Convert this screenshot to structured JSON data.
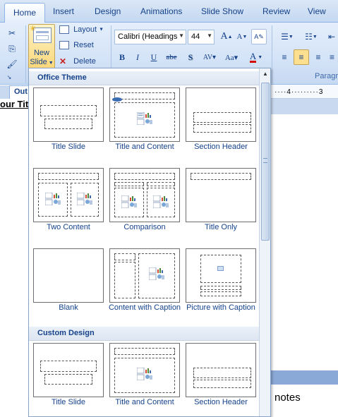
{
  "tabs": [
    {
      "label": "Home",
      "active": true
    },
    {
      "label": "Insert",
      "active": false
    },
    {
      "label": "Design",
      "active": false
    },
    {
      "label": "Animations",
      "active": false
    },
    {
      "label": "Slide Show",
      "active": false
    },
    {
      "label": "Review",
      "active": false
    },
    {
      "label": "View",
      "active": false
    }
  ],
  "ribbon": {
    "new_slide_label_1": "New",
    "new_slide_label_2": "Slide",
    "layout_label": "Layout",
    "reset_label": "Reset",
    "delete_label": "Delete",
    "font_name": "Calibri (Headings",
    "font_size": "44",
    "paragraph_group_label": "Paragr"
  },
  "document": {
    "outline_tab_label": "Out",
    "outline_title_text": "our Tit",
    "ruler_text": "····4·········3",
    "notes_text": "notes"
  },
  "gallery": {
    "sections": [
      {
        "title": "Office Theme",
        "layouts": [
          "Title Slide",
          "Title and Content",
          "Section Header",
          "Two Content",
          "Comparison",
          "Title Only",
          "Blank",
          "Content with Caption",
          "Picture with Caption"
        ]
      },
      {
        "title": "Custom Design",
        "layouts": [
          "Title Slide",
          "Title and Content",
          "Section Header"
        ]
      }
    ]
  },
  "colors": {
    "accent": "#15428b",
    "ribbon_bg": "#d4e3f7",
    "selected_button": "#fde8a4"
  }
}
